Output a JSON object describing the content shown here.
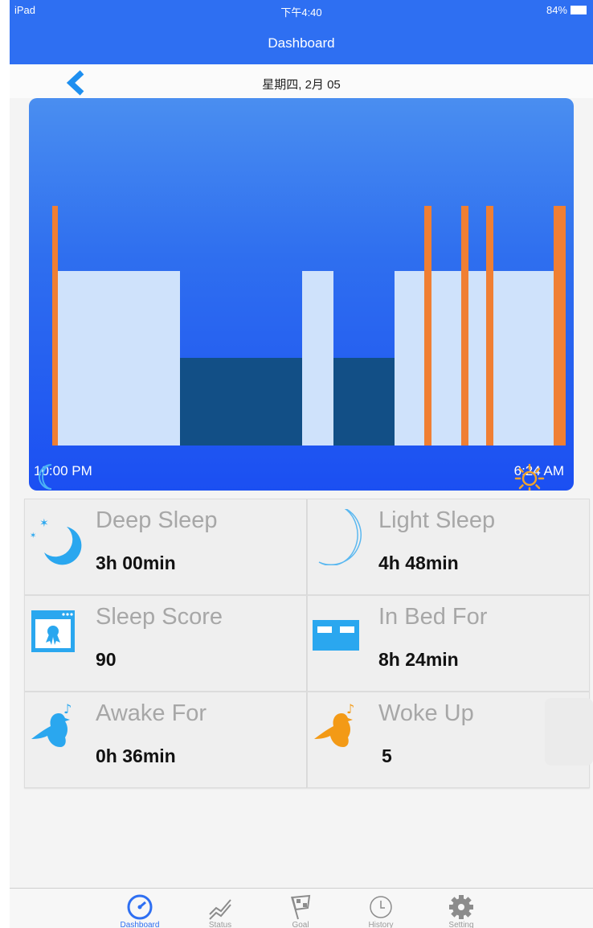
{
  "status_bar": {
    "device": "iPad",
    "time": "下午4:40",
    "battery": "84%"
  },
  "nav": {
    "title": "Dashboard",
    "date": "星期四, 2月 05"
  },
  "sleep_chart": {
    "start_time": "10:00 PM",
    "end_time": "6:24 AM",
    "colors": {
      "light": "#cfe2fb",
      "deep": "#124f86",
      "awake": "#f07f33"
    }
  },
  "stats": [
    {
      "label": "Deep Sleep",
      "value": "3h 00min",
      "icon": "moon-stars-icon"
    },
    {
      "label": "Light Sleep",
      "value": "4h 48min",
      "icon": "crescent-moon-icon"
    },
    {
      "label": "Sleep Score",
      "value": "90",
      "icon": "certificate-icon"
    },
    {
      "label": "In Bed For",
      "value": "8h 24min",
      "icon": "bed-icon"
    },
    {
      "label": "Awake For",
      "value": "0h 36min",
      "icon": "blue-bird-icon"
    },
    {
      "label": "Woke Up",
      "value": "5",
      "icon": "orange-bird-icon"
    }
  ],
  "tabs": [
    {
      "label": "Dashboard",
      "icon": "speedometer-icon",
      "active": true
    },
    {
      "label": "Status",
      "icon": "trend-icon",
      "active": false
    },
    {
      "label": "Goal",
      "icon": "flag-icon",
      "active": false
    },
    {
      "label": "History",
      "icon": "clock-icon",
      "active": false
    },
    {
      "label": "Setting",
      "icon": "gear-icon",
      "active": false
    }
  ]
}
